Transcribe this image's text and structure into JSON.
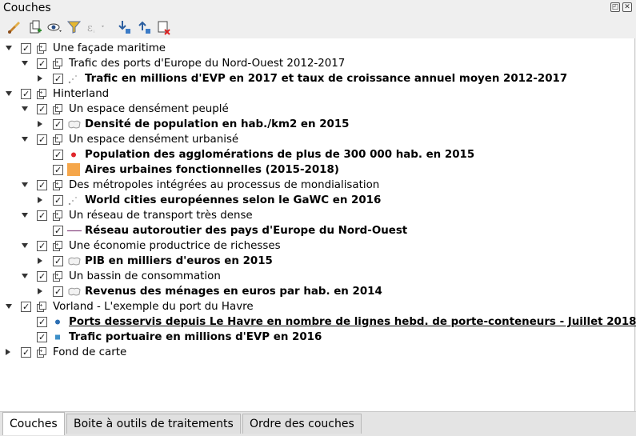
{
  "panel": {
    "title": "Couches"
  },
  "toolbar": {
    "tools": [
      "style-brush-icon",
      "add-group-icon",
      "eye-visibility-icon",
      "filter-icon",
      "expression-filter-icon",
      "expand-all-icon",
      "collapse-all-icon",
      "remove-layer-icon"
    ]
  },
  "layers": [
    {
      "text": "Une façade maritime",
      "bold": false,
      "underline": false,
      "indent": 0,
      "arrow": "down",
      "kind": "group"
    },
    {
      "text": " Trafic des ports d'Europe du Nord-Ouest 2012-2017",
      "bold": false,
      "underline": false,
      "indent": 1,
      "arrow": "down",
      "kind": "group"
    },
    {
      "text": "Trafic en millions d'EVP en 2017 et taux de croissance annuel moyen 2012-2017",
      "bold": true,
      "underline": false,
      "indent": 2,
      "arrow": "right",
      "kind": "dots"
    },
    {
      "text": "Hinterland",
      "bold": false,
      "underline": false,
      "indent": 0,
      "arrow": "down",
      "kind": "group"
    },
    {
      "text": "Un espace densément peuplé",
      "bold": false,
      "underline": false,
      "indent": 1,
      "arrow": "down",
      "kind": "group"
    },
    {
      "text": "Densité de population en hab./km2 en 2015",
      "bold": true,
      "underline": false,
      "indent": 2,
      "arrow": "right",
      "kind": "polygon"
    },
    {
      "text": "Un espace densément urbanisé",
      "bold": false,
      "underline": false,
      "indent": 1,
      "arrow": "down",
      "kind": "group"
    },
    {
      "text": "Population des agglomérations de plus de 300 000 hab. en 2015",
      "bold": true,
      "underline": false,
      "indent": 2,
      "arrow": "none",
      "kind": "red-dot"
    },
    {
      "text": "Aires urbaines fonctionnelles (2015-2018)",
      "bold": true,
      "underline": false,
      "indent": 2,
      "arrow": "none",
      "kind": "orange-square"
    },
    {
      "text": "Des métropoles intégrées au processus de mondialisation",
      "bold": false,
      "underline": false,
      "indent": 1,
      "arrow": "down",
      "kind": "group"
    },
    {
      "text": "World cities européennes selon le GaWC en 2016",
      "bold": true,
      "underline": false,
      "indent": 2,
      "arrow": "right",
      "kind": "dots"
    },
    {
      "text": "Un réseau de transport très dense",
      "bold": false,
      "underline": false,
      "indent": 1,
      "arrow": "down",
      "kind": "group"
    },
    {
      "text": "Réseau autoroutier des pays d'Europe du Nord-Ouest",
      "bold": true,
      "underline": false,
      "indent": 2,
      "arrow": "none",
      "kind": "line"
    },
    {
      "text": "Une économie productrice de richesses",
      "bold": false,
      "underline": false,
      "indent": 1,
      "arrow": "down",
      "kind": "group"
    },
    {
      "text": "PIB en milliers d'euros en 2015",
      "bold": true,
      "underline": false,
      "indent": 2,
      "arrow": "right",
      "kind": "polygon"
    },
    {
      "text": "Un bassin de consommation",
      "bold": false,
      "underline": false,
      "indent": 1,
      "arrow": "down",
      "kind": "group"
    },
    {
      "text": "Revenus des ménages en euros par hab. en 2014",
      "bold": true,
      "underline": false,
      "indent": 2,
      "arrow": "right",
      "kind": "polygon"
    },
    {
      "text": "Vorland - L'exemple du port du Havre",
      "bold": false,
      "underline": false,
      "indent": 0,
      "arrow": "down",
      "kind": "group"
    },
    {
      "text": "Ports desservis depuis Le Havre en nombre de lignes hebd. de porte-conteneurs - Juillet 2018",
      "bold": true,
      "underline": true,
      "indent": 1,
      "arrow": "none",
      "kind": "blue-dot"
    },
    {
      "text": "Trafic portuaire en millions d'EVP en 2016",
      "bold": true,
      "underline": false,
      "indent": 1,
      "arrow": "none",
      "kind": "blue-square"
    },
    {
      "text": "Fond de carte",
      "bold": false,
      "underline": false,
      "indent": 0,
      "arrow": "right",
      "kind": "group"
    }
  ],
  "tabs": [
    {
      "label": "Couches",
      "active": true
    },
    {
      "label": "Boite à outils de traitements",
      "active": false
    },
    {
      "label": "Ordre des couches",
      "active": false
    }
  ],
  "colors": {
    "red_dot": "#e0262b",
    "orange_square": "#f5a64a",
    "line": "#8e4f86",
    "blue_dot": "#2c6fb3",
    "blue_square": "#3d8fc8"
  }
}
